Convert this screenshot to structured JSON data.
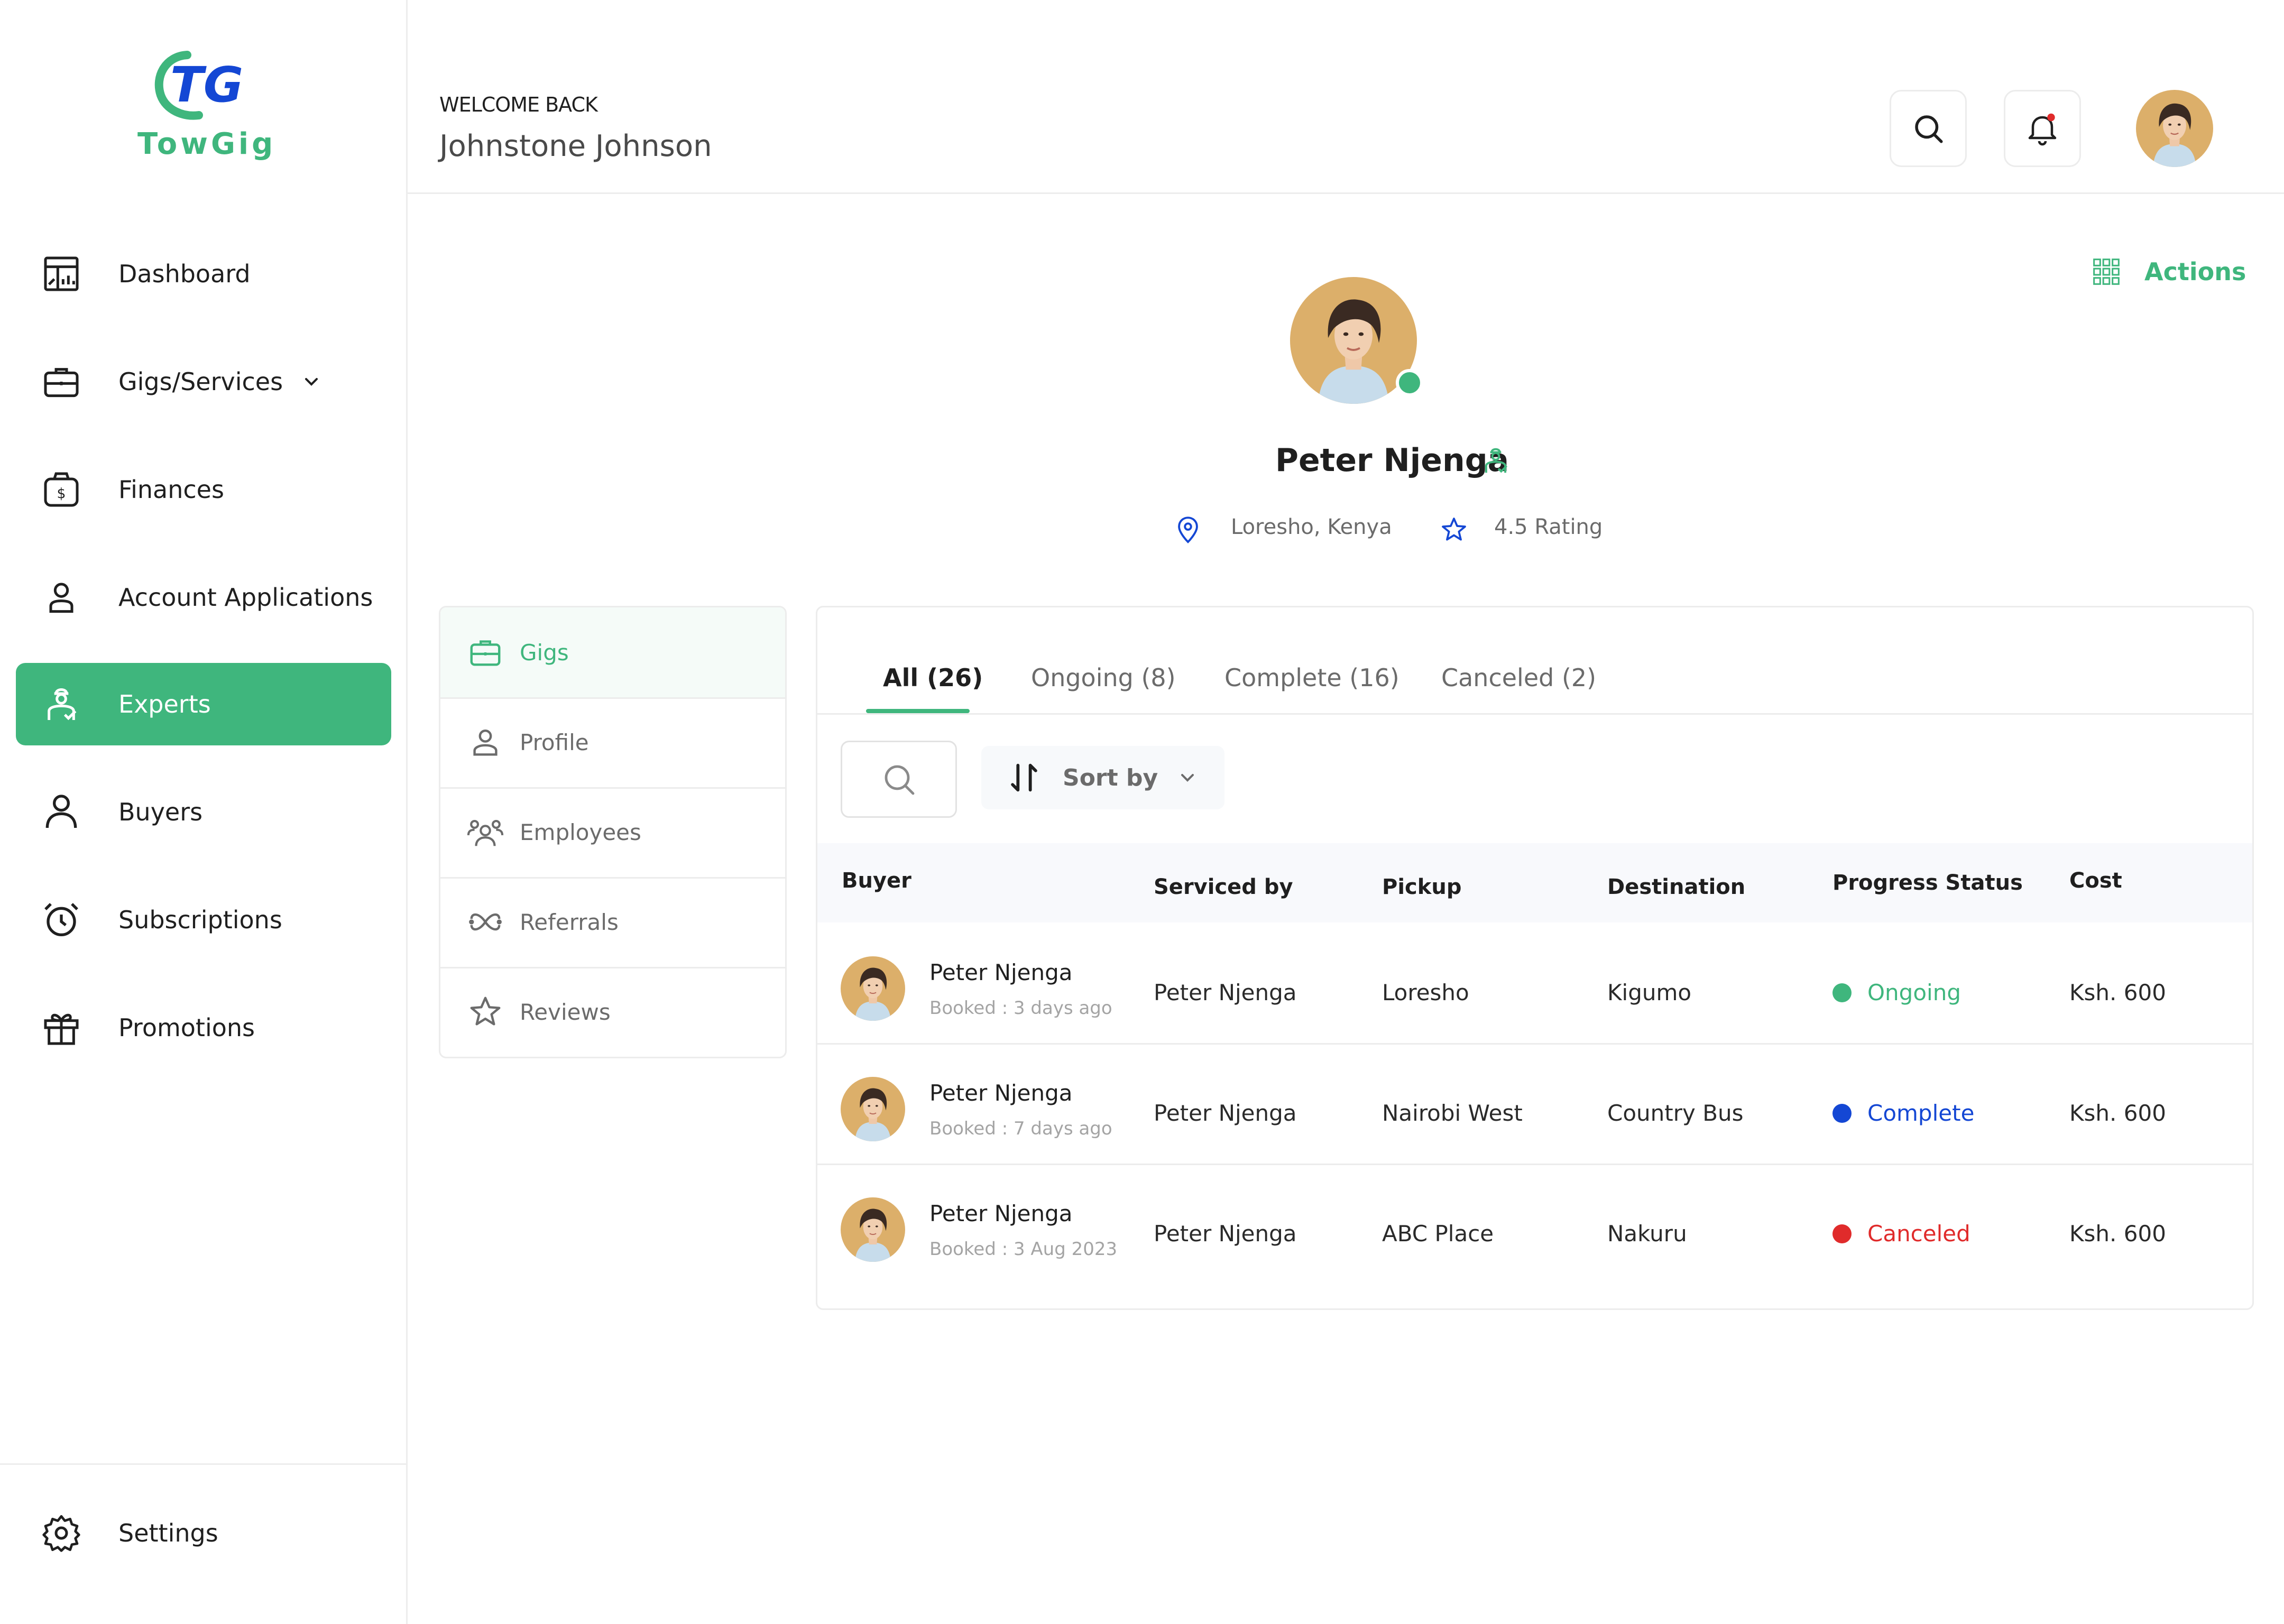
{
  "brand": {
    "name": "TowGig",
    "mark": "TG"
  },
  "sidebar": {
    "items": [
      {
        "label": "Dashboard",
        "icon": "dashboard-icon"
      },
      {
        "label": "Gigs/Services",
        "icon": "briefcase-icon",
        "has_dropdown": true
      },
      {
        "label": "Finances",
        "icon": "money-bag-icon"
      },
      {
        "label": "Account Applications",
        "icon": "user-icon"
      },
      {
        "label": "Experts",
        "icon": "expert-icon",
        "active": true
      },
      {
        "label": "Buyers",
        "icon": "person-icon"
      },
      {
        "label": "Subscriptions",
        "icon": "alarm-clock-icon"
      },
      {
        "label": "Promotions",
        "icon": "gift-icon"
      }
    ],
    "settings_label": "Settings"
  },
  "header": {
    "welcome": "WELCOME BACK",
    "user_name": "Johnstone Johnson",
    "notification_unread": true
  },
  "profile": {
    "name": "Peter Njenga",
    "online": true,
    "location": "Loresho, Kenya",
    "rating": "4.5 Rating",
    "actions_label": "Actions"
  },
  "submenu": {
    "items": [
      {
        "label": "Gigs",
        "icon": "briefcase-icon",
        "active": true
      },
      {
        "label": "Profile",
        "icon": "user-icon"
      },
      {
        "label": "Employees",
        "icon": "users-icon"
      },
      {
        "label": "Referrals",
        "icon": "referral-icon"
      },
      {
        "label": "Reviews",
        "icon": "star-icon"
      }
    ]
  },
  "gigs": {
    "tabs": [
      {
        "label": "All (26)",
        "active": true
      },
      {
        "label": "Ongoing (8)"
      },
      {
        "label": "Complete (16)"
      },
      {
        "label": "Canceled (2)"
      }
    ],
    "sort_label": "Sort by",
    "columns": [
      "Buyer",
      "Serviced by",
      "Pickup",
      "Destination",
      "Progress Status",
      "Cost"
    ],
    "rows": [
      {
        "buyer": "Peter Njenga",
        "booked": "Booked : 3 days ago",
        "serviced_by": "Peter Njenga",
        "pickup": "Loresho",
        "destination": "Kigumo",
        "status": "Ongoing",
        "status_color": "#3fb67d",
        "cost": "Ksh. 600"
      },
      {
        "buyer": "Peter Njenga",
        "booked": "Booked : 7 days ago",
        "serviced_by": "Peter Njenga",
        "pickup": "Nairobi West",
        "destination": "Country Bus",
        "status": "Complete",
        "status_color": "#1447d4",
        "cost": "Ksh. 600"
      },
      {
        "buyer": "Peter Njenga",
        "booked": "Booked : 3 Aug 2023",
        "serviced_by": "Peter Njenga",
        "pickup": "ABC Place",
        "destination": "Nakuru",
        "status": "Canceled",
        "status_color": "#e02b2b",
        "cost": "Ksh. 600"
      }
    ]
  },
  "colors": {
    "accent": "#3fb67d",
    "brand_blue": "#1447d4",
    "danger": "#e02b2b",
    "notification": "#e02b2b"
  }
}
